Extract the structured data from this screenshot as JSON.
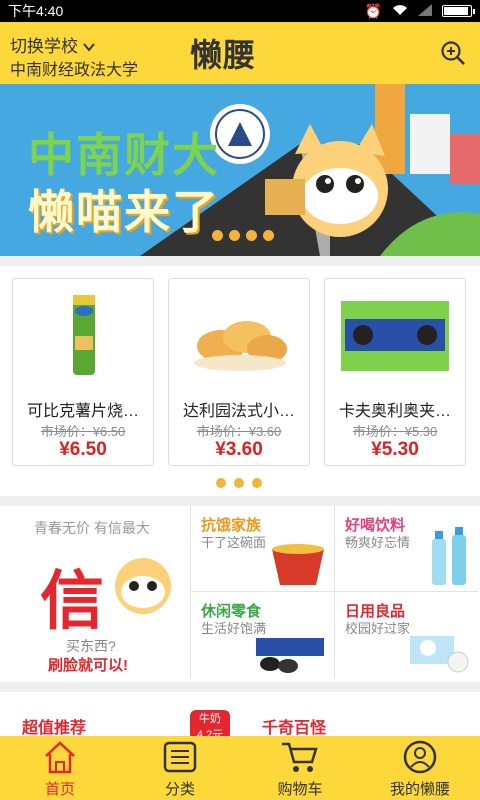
{
  "status_bar": {
    "time": "下午4:40"
  },
  "header": {
    "switch_label": "切换学校",
    "school": "中南财经政法大学",
    "logo": "懒腰"
  },
  "banner": {
    "line1": "中南财大",
    "line2": "懒喵来了",
    "page_indicator_count": 4
  },
  "products": [
    {
      "name": "可比克薯片烧…",
      "market_price": "市场价：¥6.50",
      "price": "¥6.50"
    },
    {
      "name": "达利园法式小…",
      "market_price": "市场价：¥3.60",
      "price": "¥3.60"
    },
    {
      "name": "卡夫奥利奥夹…",
      "market_price": "市场价：¥5.30",
      "price": "¥5.30"
    }
  ],
  "product_pager_count": 3,
  "promo": {
    "slogan": "青春无价 有信最大",
    "big_char": "信",
    "question": "买东西?",
    "answer": "刷脸就可以!",
    "cells": [
      {
        "title": "抗饿家族",
        "subtitle": "干了这碗面",
        "color": "#e89a1e"
      },
      {
        "title": "好喝饮料",
        "subtitle": "畅爽好忘情",
        "color": "#e0437e"
      },
      {
        "title": "休闲零食",
        "subtitle": "生活好饱满",
        "color": "#3aa844"
      },
      {
        "title": "日用良品",
        "subtitle": "校园好过家",
        "color": "#e6262e"
      }
    ]
  },
  "strip": {
    "left": "超值推荐",
    "badge": "牛奶",
    "badge_sub": "4.2元",
    "right": "千奇百怪"
  },
  "tabbar": {
    "tabs": [
      {
        "label": "首页",
        "icon": "home-icon",
        "active": true
      },
      {
        "label": "分类",
        "icon": "list-icon",
        "active": false
      },
      {
        "label": "购物车",
        "icon": "cart-icon",
        "active": false
      },
      {
        "label": "我的懒腰",
        "icon": "user-icon",
        "active": false
      }
    ]
  },
  "colors": {
    "accent": "#fdd83a",
    "price": "#e02020",
    "indicator": "#f4b43a"
  }
}
